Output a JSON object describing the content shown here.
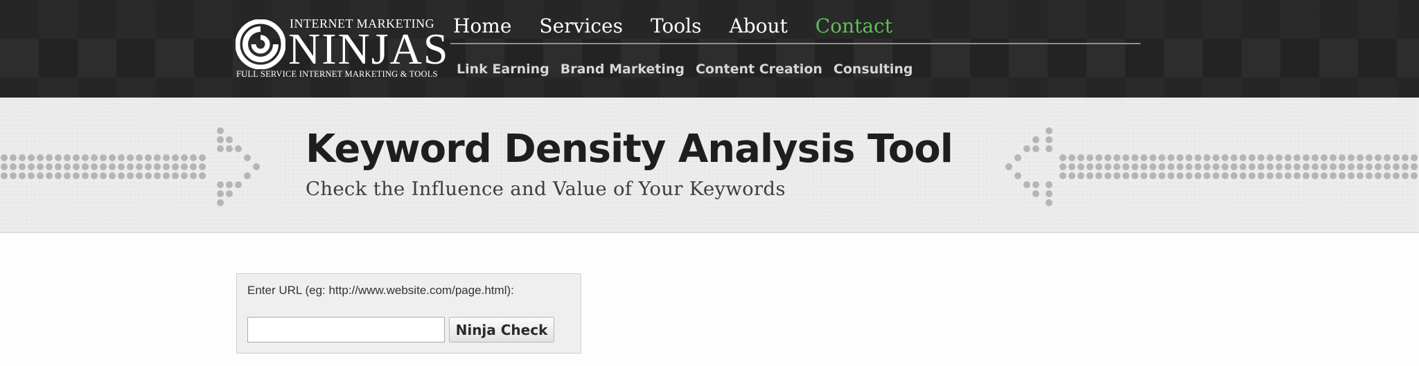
{
  "header": {
    "logo": {
      "top_text": "INTERNET MARKETING",
      "main_text": "NINJAS",
      "sub_text": "FULL SERVICE INTERNET MARKETING & TOOLS"
    },
    "nav": [
      {
        "label": "Home",
        "active": false
      },
      {
        "label": "Services",
        "active": false
      },
      {
        "label": "Tools",
        "active": false
      },
      {
        "label": "About",
        "active": false
      },
      {
        "label": "Contact",
        "active": true
      }
    ],
    "subnav": [
      "Link Earning",
      "Brand Marketing",
      "Content Creation",
      "Consulting"
    ]
  },
  "banner": {
    "title": "Keyword Density Analysis Tool",
    "subtitle": "Check the Influence and Value of Your Keywords"
  },
  "form": {
    "label": "Enter URL (eg: http://www.website.com/page.html):",
    "input_value": "",
    "input_placeholder": "",
    "button_label": "Ninja Check"
  },
  "colors": {
    "header_bg": "#262626",
    "accent_active": "#5fbf57",
    "banner_bg": "#ececec",
    "dots": "#b5b5b5"
  }
}
